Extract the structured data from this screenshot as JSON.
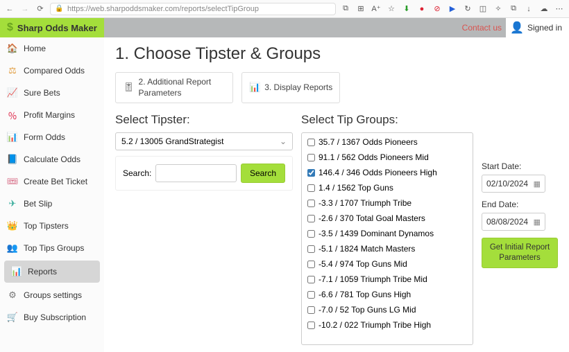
{
  "browser": {
    "url": "https://web.sharpoddsmaker.com/reports/selectTipGroup"
  },
  "brand": {
    "name": "Sharp Odds Maker"
  },
  "header": {
    "contact": "Contact us",
    "signed_in": "Signed in"
  },
  "sidebar": {
    "items": [
      {
        "label": "Home",
        "icon": "🏠",
        "color": "#4aa3d6"
      },
      {
        "label": "Compared Odds",
        "icon": "⚖",
        "color": "#e09a3a"
      },
      {
        "label": "Sure Bets",
        "icon": "📈",
        "color": "#4aa34a"
      },
      {
        "label": "Profit Margins",
        "icon": "％",
        "color": "#d24"
      },
      {
        "label": "Form Odds",
        "icon": "📊",
        "color": "#e08a00"
      },
      {
        "label": "Calculate Odds",
        "icon": "📘",
        "color": "#6a8fb5"
      },
      {
        "label": "Create Bet Ticket",
        "icon": "🎟",
        "color": "#c46"
      },
      {
        "label": "Bet Slip",
        "icon": "✈",
        "color": "#3a9"
      },
      {
        "label": "Top Tipsters",
        "icon": "👑",
        "color": "#d4af37"
      },
      {
        "label": "Top Tips Groups",
        "icon": "👥",
        "color": "#b58a3a"
      },
      {
        "label": "Reports",
        "icon": "📊",
        "color": "#8ac24a",
        "active": true
      },
      {
        "label": "Groups settings",
        "icon": "⚙",
        "color": "#777"
      },
      {
        "label": "Buy Subscription",
        "icon": "🛒",
        "color": "#d24"
      }
    ]
  },
  "main": {
    "title": "1. Choose Tipster & Groups",
    "crumb2": {
      "label": "2. Additional Report Parameters",
      "icon": "🎚"
    },
    "crumb3": {
      "label": "3. Display Reports",
      "icon": "📊"
    },
    "tipster_label": "Select Tipster:",
    "tipster_selected": "5.2 / 13005 GrandStrategist",
    "search_label": "Search:",
    "search_btn": "Search",
    "groups_label": "Select Tip Groups:",
    "groups": [
      {
        "label": "35.7 / 1367 Odds Pioneers",
        "checked": false
      },
      {
        "label": "91.1 / 562 Odds Pioneers Mid",
        "checked": false
      },
      {
        "label": "146.4 / 346 Odds Pioneers High",
        "checked": true
      },
      {
        "label": "1.4 / 1562 Top Guns",
        "checked": false
      },
      {
        "label": "-3.3 / 1707 Triumph Tribe",
        "checked": false
      },
      {
        "label": "-2.6 / 370 Total Goal Masters",
        "checked": false
      },
      {
        "label": "-3.5 / 1439 Dominant Dynamos",
        "checked": false
      },
      {
        "label": "-5.1 / 1824 Match Masters",
        "checked": false
      },
      {
        "label": "-5.4 / 974 Top Guns Mid",
        "checked": false
      },
      {
        "label": "-7.1 / 1059 Triumph Tribe Mid",
        "checked": false
      },
      {
        "label": "-6.6 / 781 Top Guns High",
        "checked": false
      },
      {
        "label": "-7.0 / 52 Top Guns LG Mid",
        "checked": false
      },
      {
        "label": "-10.2 / 022 Triumph Tribe High",
        "checked": false
      }
    ],
    "start_label": "Start Date:",
    "start_value": "02/10/2024",
    "end_label": "End Date:",
    "end_value": "08/08/2024",
    "get_btn": "Get Initial Report Parameters"
  }
}
